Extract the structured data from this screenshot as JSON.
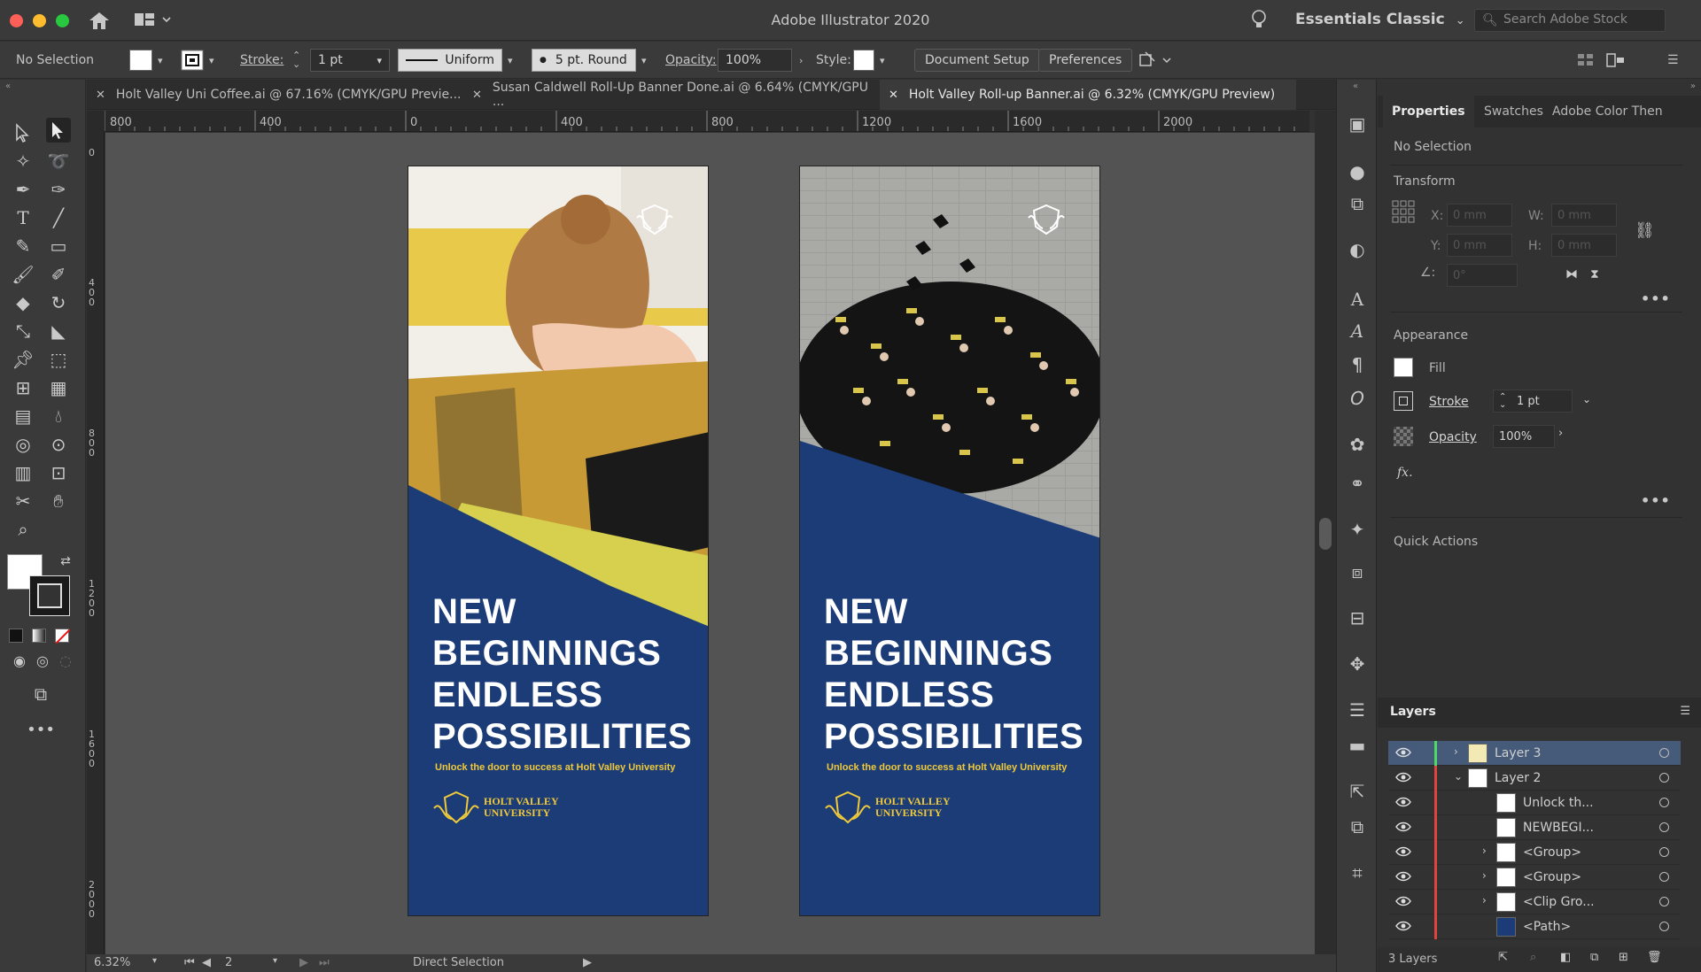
{
  "app": {
    "title": "Adobe Illustrator 2020",
    "workspace": "Essentials Classic",
    "search_placeholder": "Search Adobe Stock"
  },
  "control_bar": {
    "selection": "No Selection",
    "stroke_label": "Stroke:",
    "stroke_value": "1 pt",
    "stroke_profile": "Uniform",
    "brush": "5 pt. Round",
    "opacity_label": "Opacity:",
    "opacity_value": "100%",
    "style_label": "Style:",
    "document_setup": "Document Setup",
    "preferences": "Preferences"
  },
  "tabs": [
    {
      "label": "Holt Valley Uni Coffee.ai @ 67.16% (CMYK/GPU Previe...",
      "active": false
    },
    {
      "label": "Susan Caldwell Roll-Up Banner Done.ai @ 6.64% (CMYK/GPU ...",
      "active": false
    },
    {
      "label": "Holt Valley Roll-up Banner.ai @ 6.32% (CMYK/GPU Preview)",
      "active": true
    }
  ],
  "ruler": {
    "h": [
      "800",
      "400",
      "0",
      "400",
      "800",
      "1200",
      "1600",
      "2000"
    ],
    "v": [
      "0",
      "400",
      "800",
      "1200",
      "1600",
      "2000"
    ]
  },
  "banners": [
    {
      "headline": [
        "NEW",
        "BEGINNINGS",
        "ENDLESS",
        "POSSIBILITIES"
      ],
      "tagline": "Unlock the door to success at Holt Valley University",
      "logo_text": [
        "HOLT VALLEY",
        "UNIVERSITY"
      ],
      "photo": "woman-laughing"
    },
    {
      "headline": [
        "NEW",
        "BEGINNINGS",
        "ENDLESS",
        "POSSIBILITIES"
      ],
      "tagline": "Unlock the door to success at Holt Valley University",
      "logo_text": [
        "HOLT VALLEY",
        "UNIVERSITY"
      ],
      "photo": "graduates-crowd"
    }
  ],
  "properties_panel": {
    "tabs": [
      "Properties",
      "Swatches",
      "Adobe Color Then"
    ],
    "selection": "No Selection",
    "transform_title": "Transform",
    "x_label": "X:",
    "y_label": "Y:",
    "w_label": "W:",
    "h_label": "H:",
    "x_value": "0 mm",
    "y_value": "0 mm",
    "w_value": "0 mm",
    "h_value": "0 mm",
    "angle_value": "0°",
    "appearance_title": "Appearance",
    "fill_label": "Fill",
    "stroke_label": "Stroke",
    "stroke_value": "1 pt",
    "opacity_label": "Opacity",
    "opacity_value": "100%",
    "fx_label": "fx.",
    "quick_actions_title": "Quick Actions"
  },
  "layers_panel": {
    "title": "Layers",
    "rows": [
      {
        "name": "Layer 3",
        "color": "#4cd964"
      },
      {
        "name": "Layer 2",
        "color": "#e0443c"
      },
      {
        "name": "Unlock th...",
        "color": "#e0443c"
      },
      {
        "name": "NEWBEGI...",
        "color": "#e0443c"
      },
      {
        "name": "<Group>",
        "color": "#e0443c"
      },
      {
        "name": "<Group>",
        "color": "#e0443c"
      },
      {
        "name": "<Clip Gro...",
        "color": "#e0443c"
      },
      {
        "name": "<Path>",
        "color": "#e0443c"
      }
    ],
    "footer": "3 Layers"
  },
  "status_bar": {
    "zoom": "6.32%",
    "artboard": "2",
    "tool": "Direct Selection"
  }
}
